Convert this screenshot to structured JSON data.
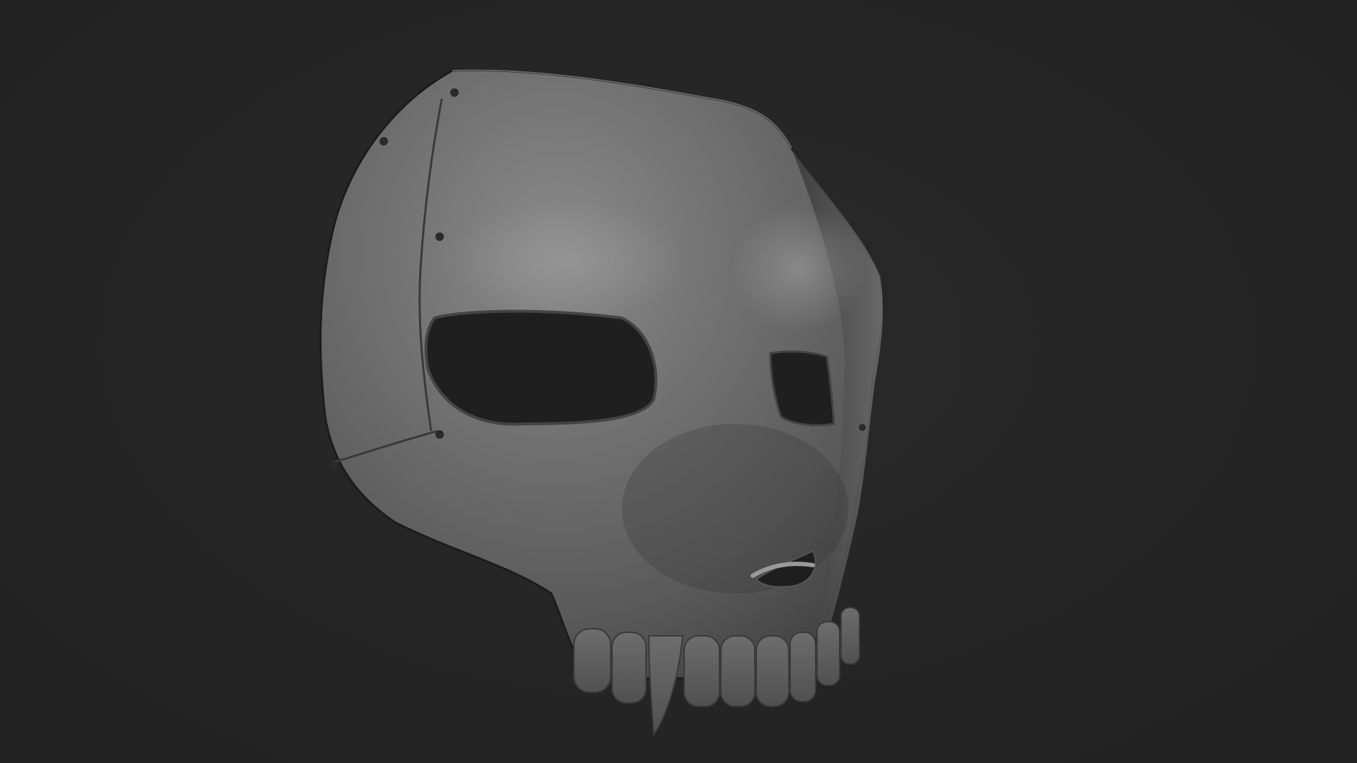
{
  "scene": {
    "subject_icon": "skull-mask-render",
    "background_color": "#262626",
    "material_color": "#6f6f6f",
    "hole_color": "#1f1f1f"
  }
}
